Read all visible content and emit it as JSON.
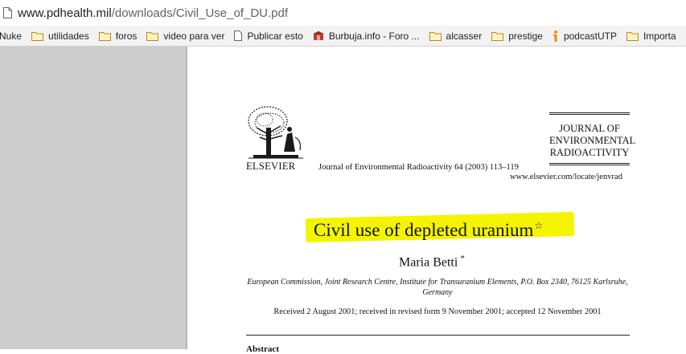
{
  "browser": {
    "url_host": "www.pdhealth.mil",
    "url_path": "/downloads/Civil_Use_of_DU.pdf",
    "bookmarks": [
      {
        "label": "Nuke",
        "icon": "none"
      },
      {
        "label": "utilidades",
        "icon": "folder-icon"
      },
      {
        "label": "foros",
        "icon": "folder-icon"
      },
      {
        "label": "video para ver",
        "icon": "folder-icon"
      },
      {
        "label": "Publicar esto",
        "icon": "page-icon"
      },
      {
        "label": "Burbuja.info - Foro ...",
        "icon": "burbuja-icon"
      },
      {
        "label": "alcasser",
        "icon": "folder-icon"
      },
      {
        "label": "prestige",
        "icon": "folder-icon"
      },
      {
        "label": "podcastUTP",
        "icon": "podcast-icon"
      },
      {
        "label": "Importa",
        "icon": "folder-icon"
      }
    ]
  },
  "pdf": {
    "publisher": "ELSEVIER",
    "journal_citation": "Journal of Environmental Radioactivity 64 (2003) 113–119",
    "journal_name_lines": [
      "JOURNAL OF",
      "ENVIRONMENTAL",
      "RADIOACTIVITY"
    ],
    "journal_url": "www.elsevier.com/locate/jenvrad",
    "title": "Civil use of depleted uranium",
    "title_mark": "☆",
    "author": "Maria Betti",
    "author_mark": "*",
    "affiliation": "European Commission, Joint Research Centre, Institute for Transuranium Elements, P.O. Box 2340, 76125 Karlsruhe, Germany",
    "dates": "Received 2 August 2001; received in revised form 9 November 2001; accepted 12 November 2001",
    "abstract_heading": "Abstract",
    "highlight_color": "#f4f400"
  }
}
